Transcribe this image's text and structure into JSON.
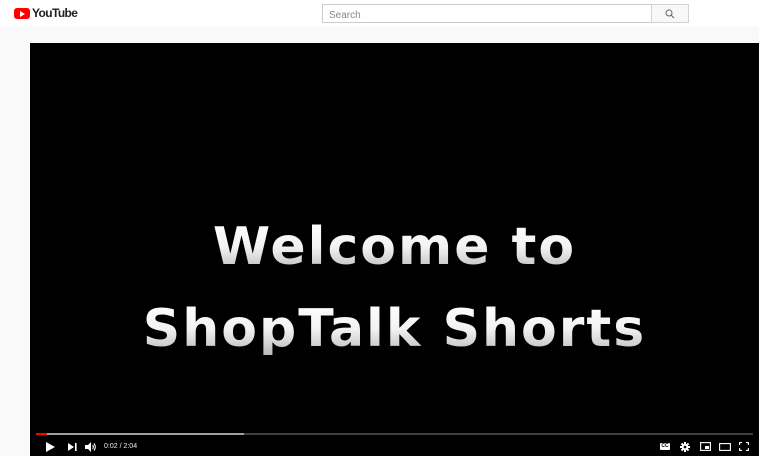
{
  "masthead": {
    "logo_text": "YouTube",
    "search_placeholder": "Search"
  },
  "video": {
    "title_line_1": "Welcome to",
    "title_line_2": "ShopTalk Shorts"
  },
  "player": {
    "time_display": "0:02 / 2:04",
    "progress_played_fraction": 0.016,
    "progress_loaded_fraction": 0.29,
    "cc_label": "CC"
  },
  "colors": {
    "brand_red": "#ff0000",
    "player_background": "#000000",
    "page_background": "#f9f9f9"
  },
  "icons": [
    "youtube-logo-icon",
    "search-icon",
    "play-icon",
    "next-icon",
    "volume-icon",
    "subtitles-icon",
    "settings-icon",
    "miniplayer-icon",
    "theater-mode-icon",
    "fullscreen-icon"
  ]
}
